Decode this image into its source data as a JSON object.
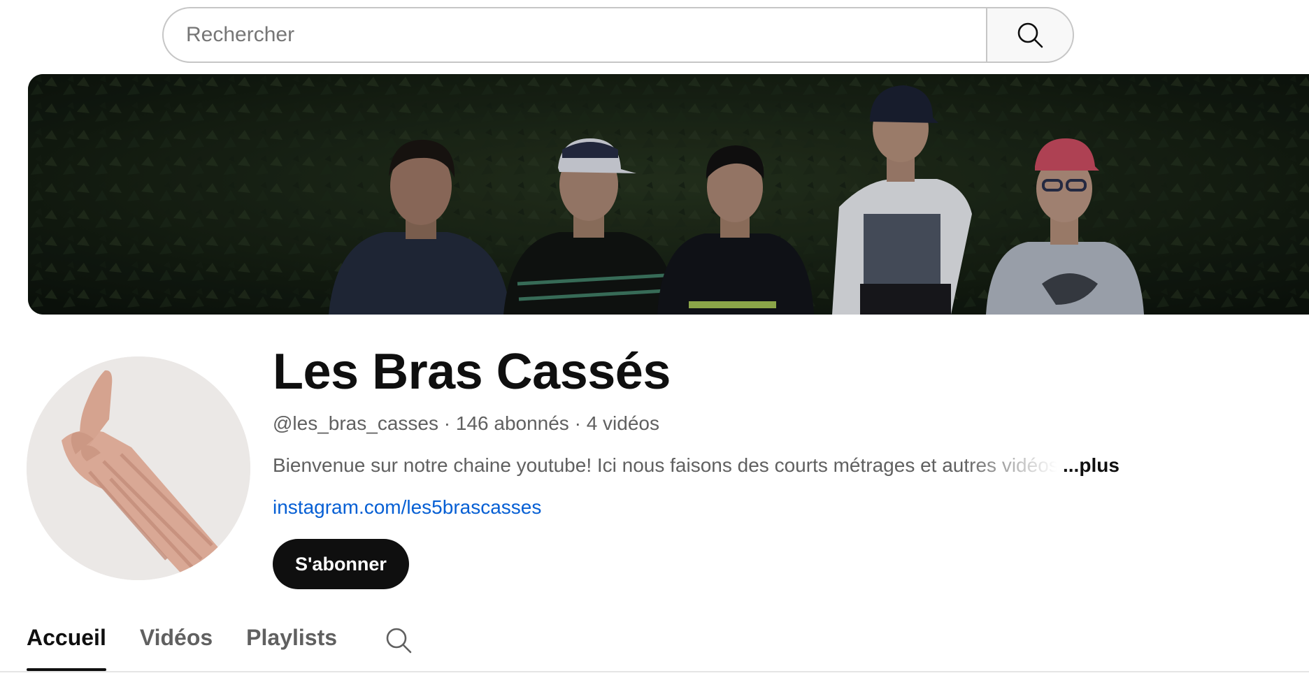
{
  "search": {
    "placeholder": "Rechercher",
    "value": "",
    "button_icon": "search-icon"
  },
  "channel": {
    "name": "Les Bras Cassés",
    "handle": "@les_bras_casses",
    "subscribers": "146 abonnés",
    "videos": "4 vidéos",
    "separator": "·",
    "description": "Bienvenue sur notre chaine youtube! Ici nous faisons des courts métrages et autres vidéos",
    "more_label": "...plus",
    "link": "instagram.com/les5brascasses",
    "subscribe_label": "S'abonner"
  },
  "tabs": [
    {
      "label": "Accueil",
      "active": true
    },
    {
      "label": "Vidéos",
      "active": false
    },
    {
      "label": "Playlists",
      "active": false
    }
  ],
  "tab_search_icon": "search-icon",
  "colors": {
    "link": "#065fd4",
    "primary_text": "#0f0f0f",
    "secondary_text": "#606060",
    "subscribe_bg": "#0f0f0f"
  }
}
